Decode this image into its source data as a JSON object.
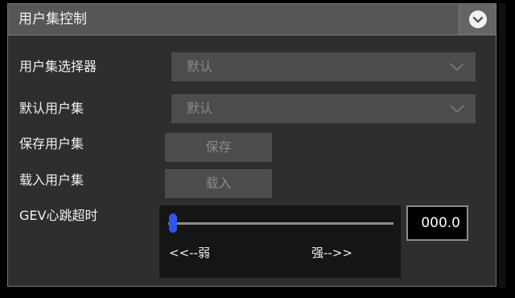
{
  "panel": {
    "title": "用户集控制",
    "collapse_icon": "chevron-down-circle-icon"
  },
  "rows": {
    "user_set_selector": {
      "label": "用户集选择器",
      "value": "默认",
      "icon": "chevron-down-icon"
    },
    "default_user_set": {
      "label": "默认用户集",
      "value": "默认",
      "icon": "chevron-down-icon"
    },
    "save_user_set": {
      "label": "保存用户集",
      "button_label": "保存"
    },
    "load_user_set": {
      "label": "载入用户集",
      "button_label": "载入"
    },
    "gev_heartbeat": {
      "label": "GEV心跳超时",
      "slider_min_label": "<<--弱",
      "slider_max_label": "强-->>",
      "slider_position_fraction": 0.02,
      "value_display": "000.0"
    }
  },
  "colors": {
    "accent": "#2f56e8",
    "panel_bg": "#2e2e2e",
    "header_bg": "#565656",
    "control_bg": "#4c4c4c",
    "disabled_text": "#898989"
  }
}
